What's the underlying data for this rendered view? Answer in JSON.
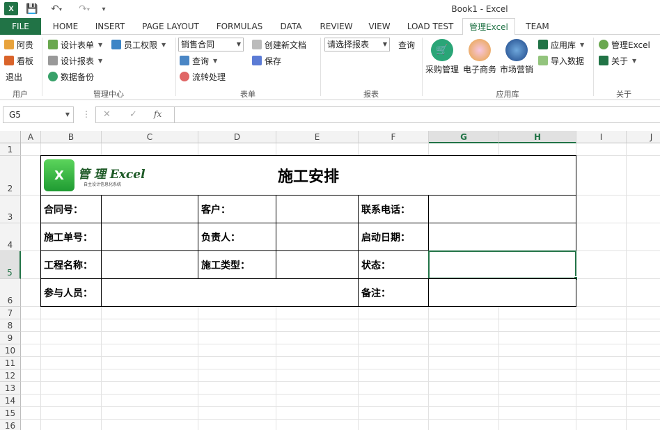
{
  "window": {
    "title": "Book1 - Excel",
    "app_icon": "X"
  },
  "tabs": [
    "FILE",
    "HOME",
    "INSERT",
    "PAGE LAYOUT",
    "FORMULAS",
    "DATA",
    "REVIEW",
    "VIEW",
    "LOAD TEST",
    "管理Excel",
    "TEAM"
  ],
  "ribbon": {
    "user": {
      "items": [
        "阿贵",
        "看板",
        "退出"
      ],
      "label": "用户"
    },
    "mgmt": {
      "items": [
        "设计表单",
        "员工权限",
        "设计报表",
        "数据备份"
      ],
      "label": "管理中心"
    },
    "form": {
      "dropdown": "销售合同",
      "items": [
        "查询",
        "流转处理",
        "创建新文档",
        "保存"
      ],
      "label": "表单"
    },
    "report": {
      "dropdown": "请选择报表",
      "query": "查询",
      "label": "报表"
    },
    "apps": {
      "items": [
        "采购管理",
        "电子商务",
        "市场营销",
        "应用库",
        "导入数据"
      ],
      "label": "应用库"
    },
    "about": {
      "items": [
        "管理Excel",
        "关于"
      ],
      "label": "关于"
    }
  },
  "formula": {
    "namebox": "G5",
    "cancel": "✕",
    "enter": "✓",
    "fx": "fx"
  },
  "columns": [
    "A",
    "B",
    "C",
    "D",
    "E",
    "F",
    "G",
    "H",
    "I",
    "J"
  ],
  "rows": [
    "1",
    "2",
    "3",
    "4",
    "5",
    "6",
    "7",
    "8",
    "9",
    "10",
    "11",
    "12",
    "13",
    "14",
    "15",
    "16"
  ],
  "sheet": {
    "logo_text": "管 理 Excel",
    "logo_sub": "自主设计信息化系统",
    "title": "施工安排",
    "labels": [
      "合同号：",
      "客户：",
      "联系电话：",
      "施工单号：",
      "负责人：",
      "启动日期：",
      "工程名称：",
      "施工类型：",
      "状态：",
      "参与人员：",
      "备注："
    ]
  },
  "colors": {
    "accent": "#217346"
  }
}
